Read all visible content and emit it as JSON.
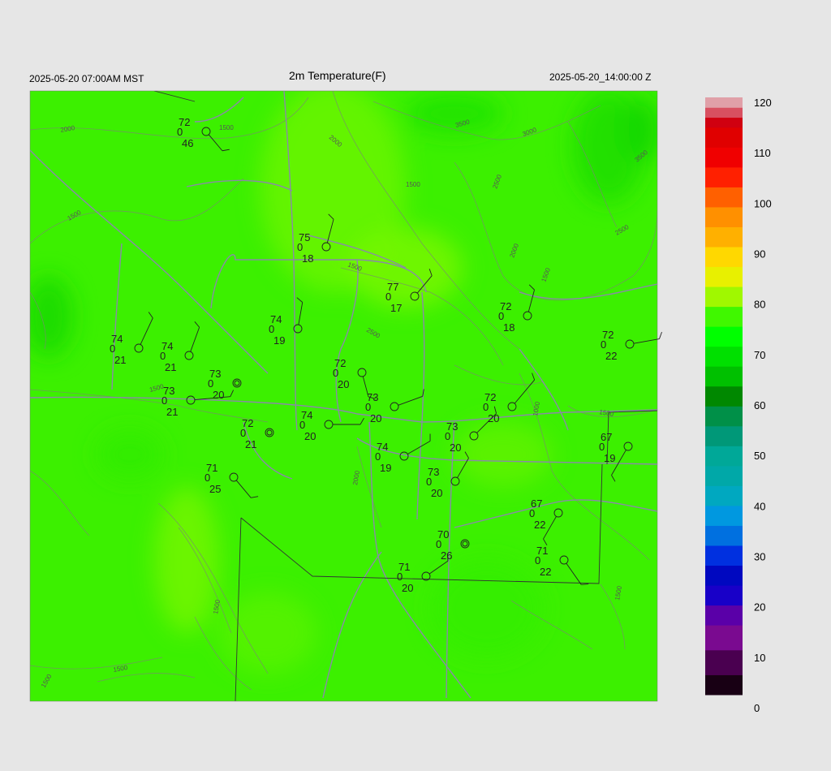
{
  "header": {
    "left": "2025-05-20 07:00AM MST",
    "title": "2m Temperature(F)",
    "right": "2025-05-20_14:00:00 Z"
  },
  "colorbar": {
    "ticks": [
      "120",
      "110",
      "100",
      "90",
      "80",
      "70",
      "60",
      "50",
      "40",
      "30",
      "20",
      "10",
      "0"
    ]
  },
  "contour_labels": [
    "2000",
    "2000",
    "3500",
    "3000",
    "3500",
    "2500",
    "1500",
    "2500",
    "2000",
    "1500",
    "1500",
    "2500",
    "1500",
    "1000",
    "1500",
    "2000",
    "1500",
    "1500",
    "1500",
    "1500",
    "1500",
    "1500"
  ],
  "stations": [
    {
      "t": "72",
      "w": "0",
      "d": "46"
    },
    {
      "t": "75",
      "w": "0",
      "d": "18"
    },
    {
      "t": "77",
      "w": "0",
      "d": "17"
    },
    {
      "t": "72",
      "w": "0",
      "d": "18"
    },
    {
      "t": "74",
      "w": "0",
      "d": "19"
    },
    {
      "t": "74",
      "w": "0",
      "d": "21"
    },
    {
      "t": "74",
      "w": "0",
      "d": "21"
    },
    {
      "t": "72",
      "w": "0",
      "d": "22"
    },
    {
      "t": "72",
      "w": "0",
      "d": "20"
    },
    {
      "t": "73",
      "w": "0",
      "d": "20"
    },
    {
      "t": "73",
      "w": "0",
      "d": "21"
    },
    {
      "t": "73",
      "w": "0",
      "d": "20"
    },
    {
      "t": "72",
      "w": "0",
      "d": "20"
    },
    {
      "t": "74",
      "w": "0",
      "d": "20"
    },
    {
      "t": "72",
      "w": "0",
      "d": "21"
    },
    {
      "t": "73",
      "w": "0",
      "d": "20"
    },
    {
      "t": "67",
      "w": "0",
      "d": "19"
    },
    {
      "t": "74",
      "w": "0",
      "d": "19"
    },
    {
      "t": "71",
      "w": "0",
      "d": "25"
    },
    {
      "t": "73",
      "w": "0",
      "d": "20"
    },
    {
      "t": "67",
      "w": "0",
      "d": "22"
    },
    {
      "t": "70",
      "w": "0",
      "d": "26"
    },
    {
      "t": "71",
      "w": "0",
      "d": "22"
    },
    {
      "t": "71",
      "w": "0",
      "d": "20"
    }
  ]
}
